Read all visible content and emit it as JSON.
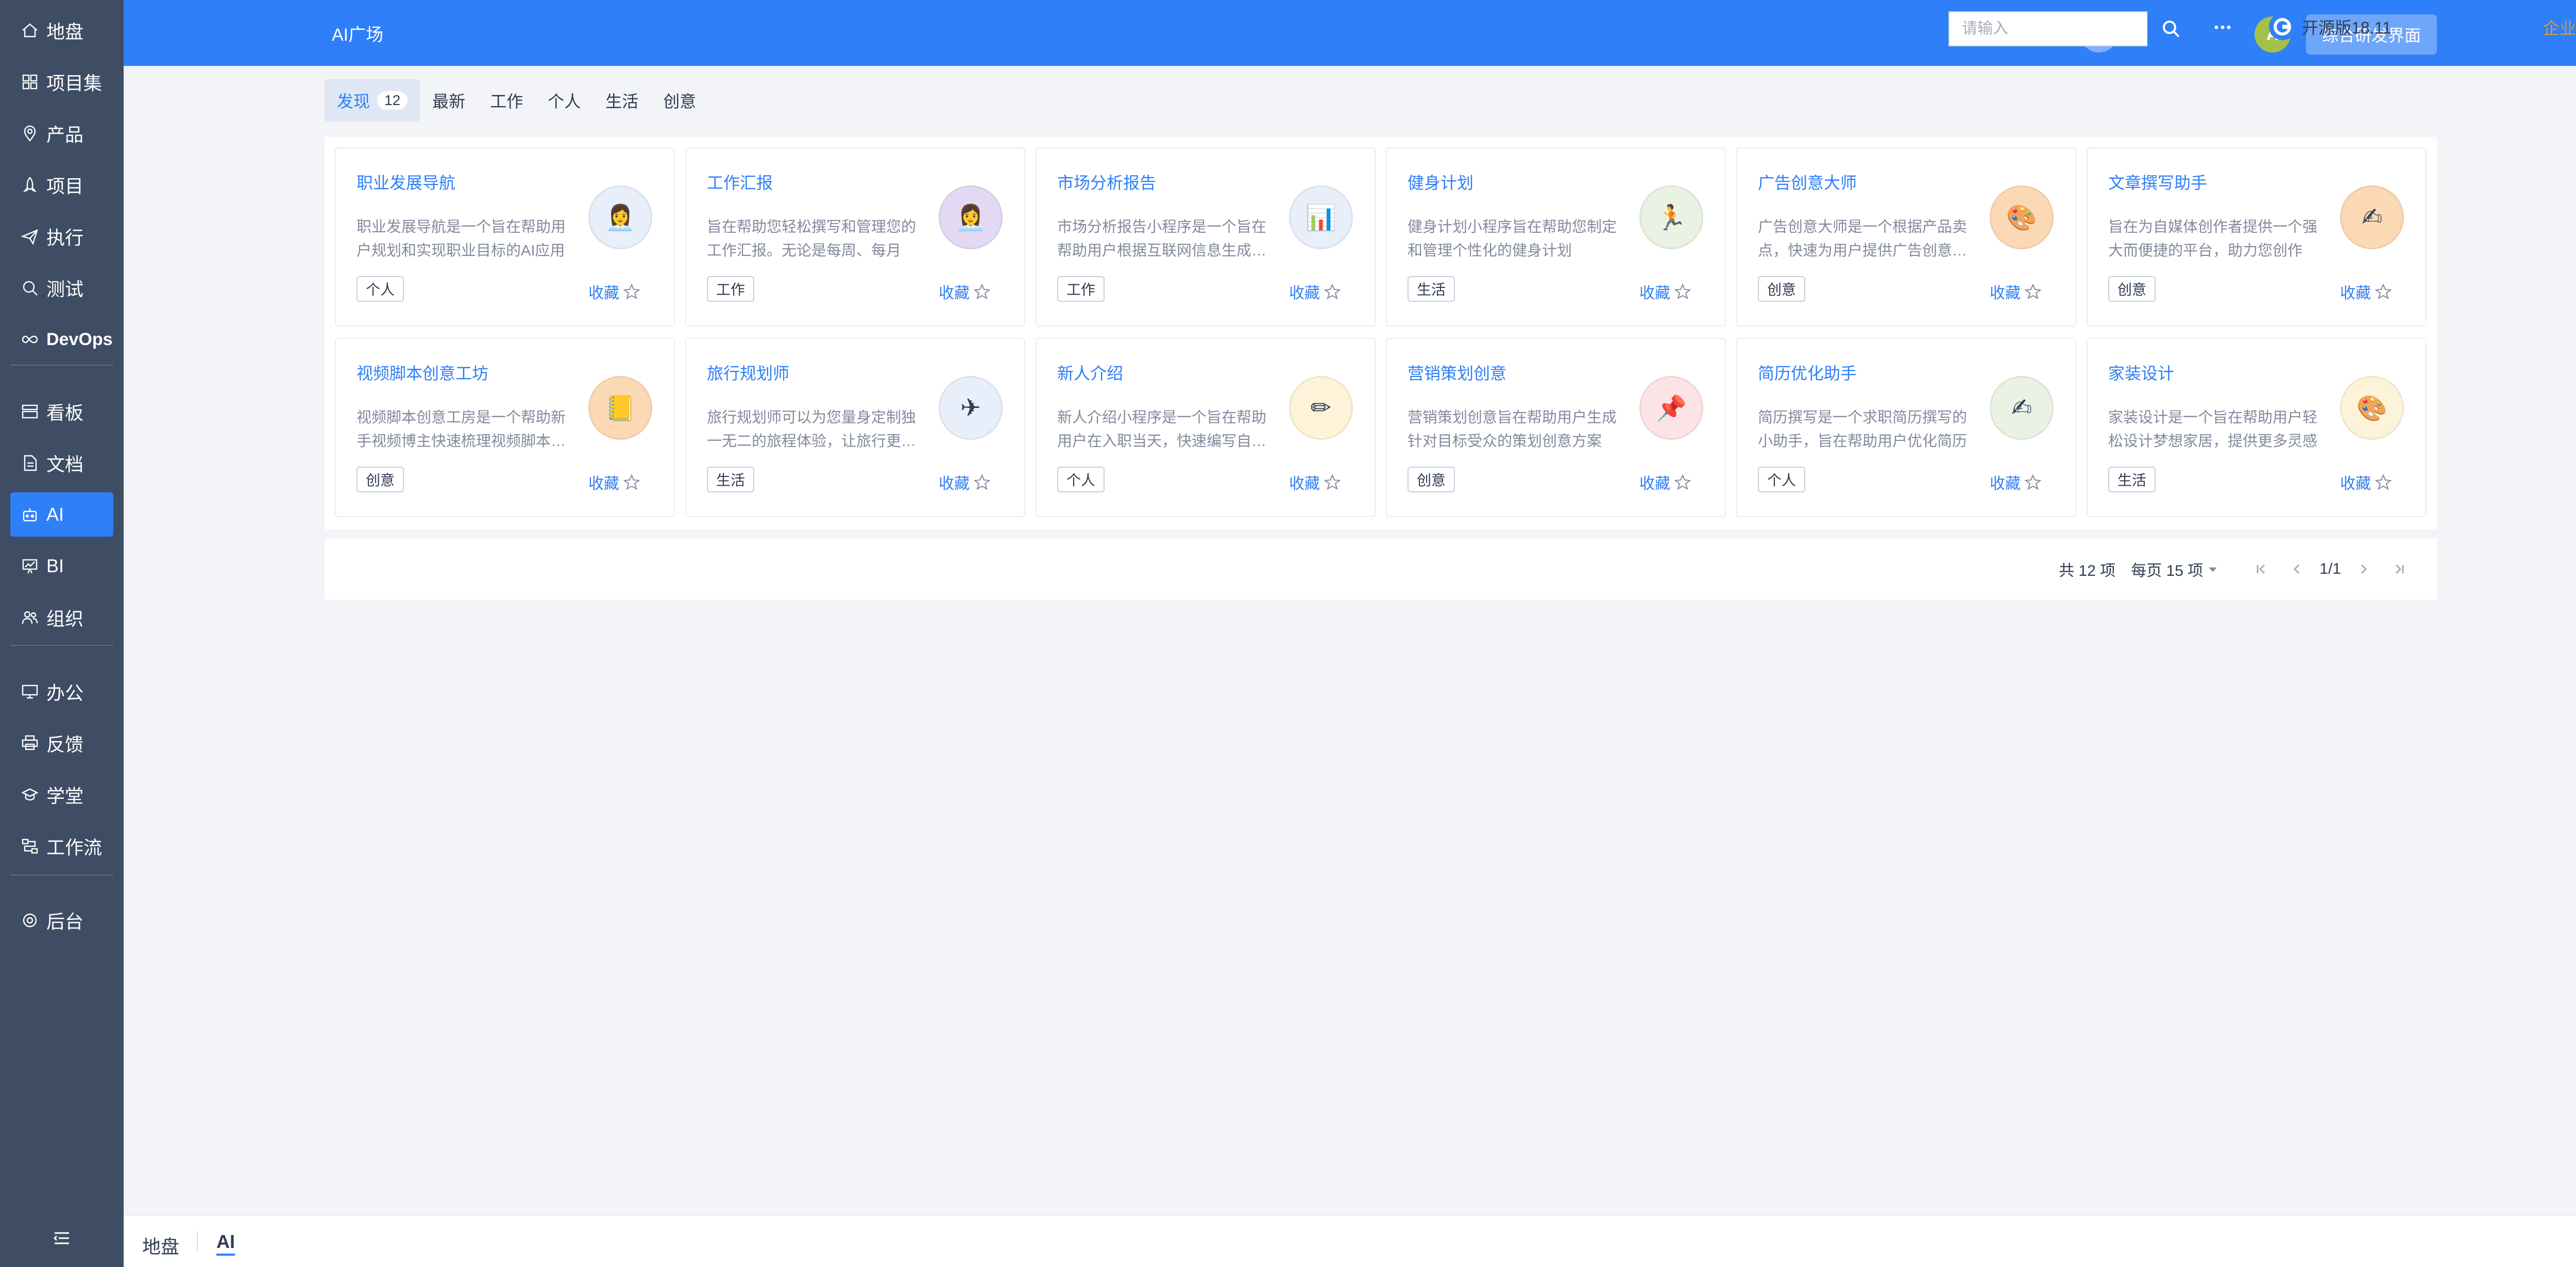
{
  "sidebar": {
    "items": [
      {
        "label": "地盘",
        "icon": "home-icon",
        "active": false
      },
      {
        "label": "项目集",
        "icon": "grid-icon",
        "active": false
      },
      {
        "label": "产品",
        "icon": "location-pin-icon",
        "active": false
      },
      {
        "label": "项目",
        "icon": "rocket-icon",
        "active": false
      },
      {
        "label": "执行",
        "icon": "send-icon",
        "active": false
      },
      {
        "label": "测试",
        "icon": "magnifier-icon",
        "active": false
      },
      {
        "label": "DevOps",
        "icon": "infinity-icon",
        "active": false
      },
      {
        "label": "看板",
        "icon": "kanban-icon",
        "active": false
      },
      {
        "label": "文档",
        "icon": "document-icon",
        "active": false
      },
      {
        "label": "AI",
        "icon": "robot-icon",
        "active": true
      },
      {
        "label": "BI",
        "icon": "chart-board-icon",
        "active": false
      },
      {
        "label": "组织",
        "icon": "people-icon",
        "active": false
      },
      {
        "label": "办公",
        "icon": "monitor-icon",
        "active": false
      },
      {
        "label": "反馈",
        "icon": "printer-icon",
        "active": false
      },
      {
        "label": "学堂",
        "icon": "graduation-icon",
        "active": false
      },
      {
        "label": "工作流",
        "icon": "workflow-icon",
        "active": false
      },
      {
        "label": "后台",
        "icon": "settings-icon",
        "active": false
      }
    ],
    "collapse_icon": "collapse-menu-icon"
  },
  "header": {
    "title": "AI广场",
    "avatar_letter": "A",
    "switch_label": "综合研发界面",
    "accent_color": "#2e7ff8"
  },
  "tabs": [
    {
      "label": "发现",
      "count": "12",
      "active": true
    },
    {
      "label": "最新",
      "count": "",
      "active": false
    },
    {
      "label": "工作",
      "count": "",
      "active": false
    },
    {
      "label": "个人",
      "count": "",
      "active": false
    },
    {
      "label": "生活",
      "count": "",
      "active": false
    },
    {
      "label": "创意",
      "count": "",
      "active": false
    }
  ],
  "cards": [
    {
      "title": "职业发展导航",
      "desc": "职业发展导航是一个旨在帮助用户规划和实现职业目标的AI应用",
      "tag": "个人",
      "fav": "收藏",
      "emoji": "👩‍💼",
      "bg": "#e8effb"
    },
    {
      "title": "工作汇报",
      "desc": "旨在帮助您轻松撰写和管理您的工作汇报。无论是每周、每月",
      "tag": "工作",
      "fav": "收藏",
      "emoji": "👩‍💼",
      "bg": "#e3d9f3"
    },
    {
      "title": "市场分析报告",
      "desc": "市场分析报告小程序是一个旨在帮助用户根据互联网信息生成报告",
      "tag": "工作",
      "fav": "收藏",
      "emoji": "📊",
      "bg": "#e8effb"
    },
    {
      "title": "健身计划",
      "desc": "健身计划小程序旨在帮助您制定和管理个性化的健身计划",
      "tag": "生活",
      "fav": "收藏",
      "emoji": "🏃",
      "bg": "#eaf2e4"
    },
    {
      "title": "广告创意大师",
      "desc": "广告创意大师是一个根据产品卖点，快速为用户提供广告创意的工具",
      "tag": "创意",
      "fav": "收藏",
      "emoji": "🎨",
      "bg": "#fbd9b4"
    },
    {
      "title": "文章撰写助手",
      "desc": "旨在为自媒体创作者提供一个强大而便捷的平台，助力您创作",
      "tag": "创意",
      "fav": "收藏",
      "emoji": "✍",
      "bg": "#fbd9b4"
    },
    {
      "title": "视频脚本创意工坊",
      "desc": "视频脚本创意工房是一个帮助新手视频博主快速梳理视频脚本的工具",
      "tag": "创意",
      "fav": "收藏",
      "emoji": "📒",
      "bg": "#fbd9b4"
    },
    {
      "title": "旅行规划师",
      "desc": "旅行规划师可以为您量身定制独一无二的旅程体验，让旅行更轻松",
      "tag": "生活",
      "fav": "收藏",
      "emoji": "✈",
      "bg": "#e8effb"
    },
    {
      "title": "新人介绍",
      "desc": "新人介绍小程序是一个旨在帮助用户在入职当天，快速编写自我介绍",
      "tag": "个人",
      "fav": "收藏",
      "emoji": "✏",
      "bg": "#fdf3d9"
    },
    {
      "title": "营销策划创意",
      "desc": "营销策划创意旨在帮助用户生成针对目标受众的策划创意方案",
      "tag": "创意",
      "fav": "收藏",
      "emoji": "📌",
      "bg": "#fbe3e6"
    },
    {
      "title": "简历优化助手",
      "desc": "简历撰写是一个求职简历撰写的小助手，旨在帮助用户优化简历",
      "tag": "个人",
      "fav": "收藏",
      "emoji": "✍",
      "bg": "#eaf2e4"
    },
    {
      "title": "家装设计",
      "desc": "家装设计是一个旨在帮助用户轻松设计梦想家居，提供更多灵感",
      "tag": "生活",
      "fav": "收藏",
      "emoji": "🎨",
      "bg": "#fdf3d9"
    }
  ],
  "pager": {
    "total": "共 12 项",
    "per_page": "每页 15 项",
    "page": "1/1"
  },
  "footer": {
    "crumb_home": "地盘",
    "crumb_current": "AI",
    "search_placeholder": "请输入",
    "version": "开源版18.11",
    "edition": "企业版",
    "edition_help": "?"
  }
}
